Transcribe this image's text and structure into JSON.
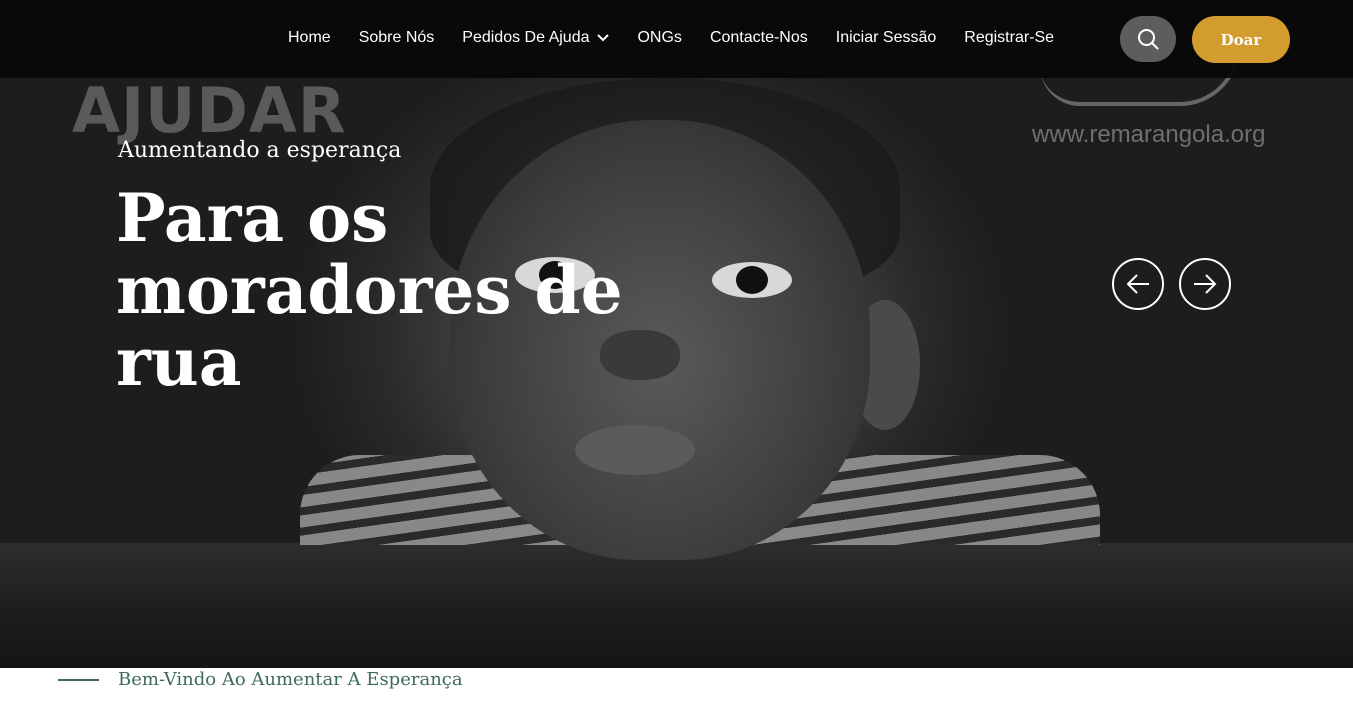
{
  "nav": {
    "items": [
      {
        "label": "Home"
      },
      {
        "label": "Sobre Nós"
      },
      {
        "label": "Pedidos De Ajuda",
        "has_dropdown": true
      },
      {
        "label": "ONGs"
      },
      {
        "label": "Contacte-Nos"
      },
      {
        "label": "Iniciar Sessão"
      },
      {
        "label": "Registrar-Se"
      }
    ],
    "search_icon": "search-icon",
    "donate_label": "Doar"
  },
  "hero": {
    "watermark_left": "AJUDAR",
    "watermark_right": "www.remarangola.org",
    "subtitle": "Aumentando a esperança",
    "title": "Para os moradores de rua",
    "prev_icon": "arrow-left-icon",
    "next_icon": "arrow-right-icon"
  },
  "welcome": {
    "text": "Bem-Vindo Ao Aumentar A Esperança"
  },
  "colors": {
    "nav_background": "#080808",
    "donate_button": "#d39c2f",
    "search_button": "#5d5d5d",
    "welcome_accent": "#3e6b57"
  }
}
